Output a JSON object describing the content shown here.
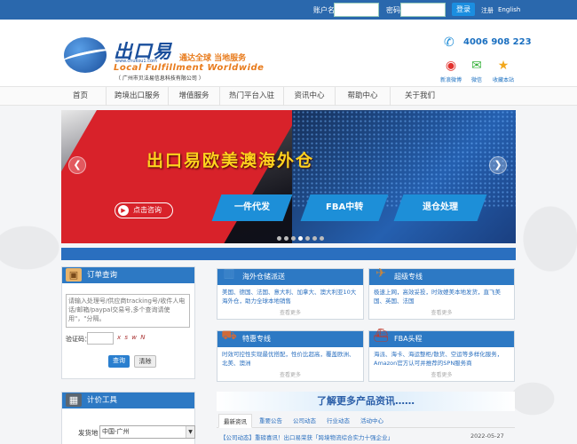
{
  "topbar": {
    "account_label": "账户名",
    "password_label": "密码",
    "login_button": "登录",
    "register_link": "注册",
    "english_link": "English"
  },
  "header": {
    "logo_cn": "出口易",
    "logo_url": "www.chukou1.com",
    "slogan": "通达全球 当地服务",
    "logo_en": "Local Fulfillment Worldwide",
    "company": "（ 广州市贝法易信息科技有限公司 ）",
    "phone": "4006 908 223",
    "social": [
      {
        "label": "新浪微博",
        "icon": "weibo-icon"
      },
      {
        "label": "微信",
        "icon": "wechat-icon"
      },
      {
        "label": "收藏本站",
        "icon": "star-icon"
      }
    ]
  },
  "nav": {
    "items": [
      "首页",
      "跨境出口服务",
      "增值服务",
      "热门平台入驻",
      "资讯中心",
      "帮助中心",
      "关于我们"
    ]
  },
  "banner": {
    "title": "出口易欧美澳海外仓",
    "consult_button": "点击咨询",
    "panels": [
      "一件代发",
      "FBA中转",
      "退仓处理"
    ],
    "prev_arrow": "❮",
    "next_arrow": "❯",
    "slide_count": 7,
    "active_slide": 3
  },
  "order": {
    "title": "订单查询",
    "placeholder": "请输入处理号/供应商tracking号/收件人电话/邮箱/paypal交易号,多个查询请使用\"，\"分隔。",
    "captcha_label": "验证码：",
    "captcha_text": "x s w N",
    "query_button": "查询",
    "clear_button": "清除"
  },
  "price": {
    "title": "计价工具",
    "origin_label": "发货地",
    "origin_value": "中国-广州"
  },
  "cards": [
    {
      "title": "海外仓储派送",
      "body": "美国、德国、法国、意大利、加拿大、澳大利亚10大海外仓，助力全球本地销售",
      "more": "查看更多"
    },
    {
      "title": "超级专线",
      "body": "极速上网，高效妥投，时效媲美本地发货，直飞美国、英国、法国",
      "more": "查看更多"
    },
    {
      "title": "特惠专线",
      "body": "时效可控性实现最优搭配，性价比超高，覆盖欧洲、北美、澳洲",
      "more": "查看更多"
    },
    {
      "title": "FBA头程",
      "body": "海派、海卡、海运整柜/散货、空运等多样化服务，Amazon官方认可并推荐的SPN服务商",
      "more": "查看更多"
    }
  ],
  "news": {
    "heading": "了解更多产品资讯……",
    "tabs": [
      "最新资讯",
      "重要公告",
      "公司动态",
      "行业动态",
      "活动中心"
    ],
    "rows": [
      {
        "title": "【公司动态】重磅喜讯！出口易荣获「跨境物流综合实力十强企业」",
        "date": "2022-05-27"
      }
    ]
  },
  "colors": {
    "topbar": "#2a68ad",
    "accent": "#2d79c4",
    "banner_red": "#d8222a",
    "banner_yellow": "#ffd21e"
  }
}
